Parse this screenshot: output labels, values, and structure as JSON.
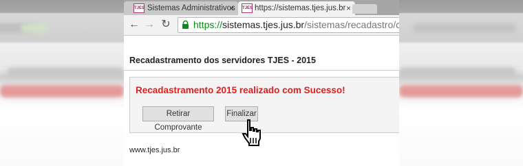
{
  "tabs": [
    {
      "label": "Sistemas Administrativos",
      "favicon": "TJES",
      "close": "×",
      "active": false
    },
    {
      "label": "https://sistemas.tjes.jus.br",
      "favicon": "TJES",
      "close": "×",
      "active": true
    }
  ],
  "toolbar": {
    "back_icon": "←",
    "forward_icon": "→",
    "reload_icon": "↻",
    "url_scheme": "https://",
    "url_host": "sistemas.tjes.jus.br",
    "url_path": "/sistemas/recadastro/cad"
  },
  "page": {
    "title": "Recadastramento dos servidores TJES - 2015",
    "success_message": "Recadastramento 2015 realizado com Sucesso!",
    "buttons": {
      "comprovante": "Retirar Comprovante",
      "finalizar": "Finalizar"
    },
    "footer": "www.tjes.jus.br"
  },
  "colors": {
    "success": "#e41b1b",
    "https": "#0a8a1a"
  }
}
